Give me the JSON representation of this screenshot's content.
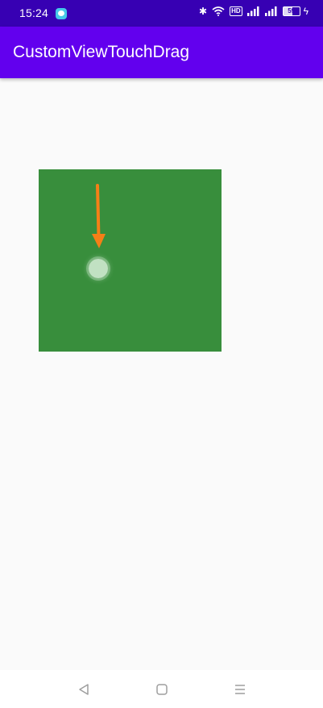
{
  "status_bar": {
    "time": "15:24",
    "notification_icon": "chat-bubble-icon",
    "icons": [
      "bluetooth-icon",
      "wifi-icon",
      "hd-icon",
      "signal-icon",
      "signal-icon",
      "battery-icon",
      "charging-icon"
    ],
    "hd_label": "HD",
    "battery_level": "59",
    "background": "#3700b3"
  },
  "app_bar": {
    "title": "CustomViewTouchDrag",
    "background": "#6200ee"
  },
  "custom_view": {
    "background": "#388e3c",
    "arrow_color": "#f57f17",
    "touch_point_color": "#c8e6c9"
  },
  "nav_bar": {
    "buttons": [
      "back-icon",
      "home-icon",
      "recents-icon"
    ]
  }
}
